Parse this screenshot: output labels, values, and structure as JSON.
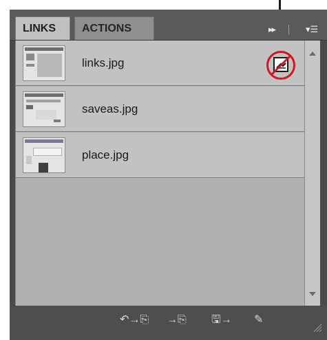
{
  "tabs": [
    {
      "label": "LINKS",
      "active": true
    },
    {
      "label": "ACTIONS",
      "active": false
    }
  ],
  "links": [
    {
      "name": "links.jpg",
      "status": "missing-or-modified"
    },
    {
      "name": "saveas.jpg"
    },
    {
      "name": "place.jpg"
    }
  ],
  "footer": {
    "relink": "↶→⎘",
    "goto": "→⎘",
    "update": "🖫→",
    "edit": "✎"
  },
  "colors": {
    "annotation_red": "#d4141f",
    "panel_dark": "#4a4a4a",
    "list_row": "#c2c2c2"
  },
  "icons": {
    "collapse": "double-chevron-right-icon",
    "panel_menu": "panel-menu-icon",
    "link_status": "link-status-icon",
    "no_symbol": "no-symbol-icon"
  }
}
